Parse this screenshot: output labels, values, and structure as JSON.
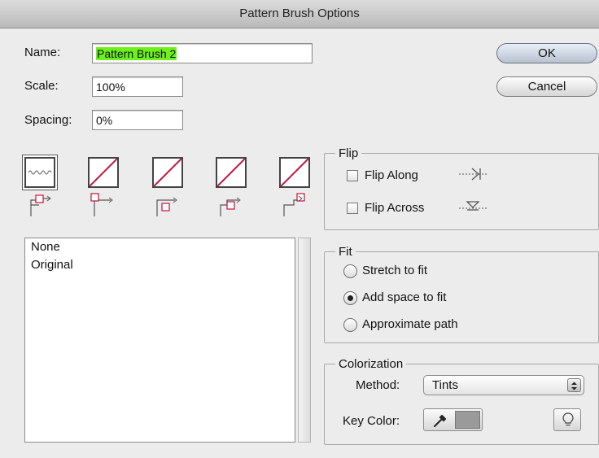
{
  "window": {
    "title": "Pattern Brush Options"
  },
  "form": {
    "name_label": "Name:",
    "name_value": "Pattern Brush 2",
    "scale_label": "Scale:",
    "scale_value": "100%",
    "spacing_label": "Spacing:",
    "spacing_value": "0%"
  },
  "buttons": {
    "ok": "OK",
    "cancel": "Cancel"
  },
  "tiles": [
    "side-tile",
    "outer-corner-tile",
    "inner-corner-tile",
    "start-tile",
    "end-tile"
  ],
  "pattern_list": [
    "None",
    "Original"
  ],
  "flip": {
    "title": "Flip",
    "along": "Flip Along",
    "across": "Flip Across"
  },
  "fit": {
    "title": "Fit",
    "options": [
      "Stretch to fit",
      "Add space to fit",
      "Approximate path"
    ],
    "selected": "Add space to fit"
  },
  "colorization": {
    "title": "Colorization",
    "method_label": "Method:",
    "method_value": "Tints",
    "key_color_label": "Key Color:",
    "key_color_swatch": "#9a9a9a"
  },
  "colors": {
    "accent_highlight": "#6df01c",
    "tile_slash": "#c0143c"
  }
}
